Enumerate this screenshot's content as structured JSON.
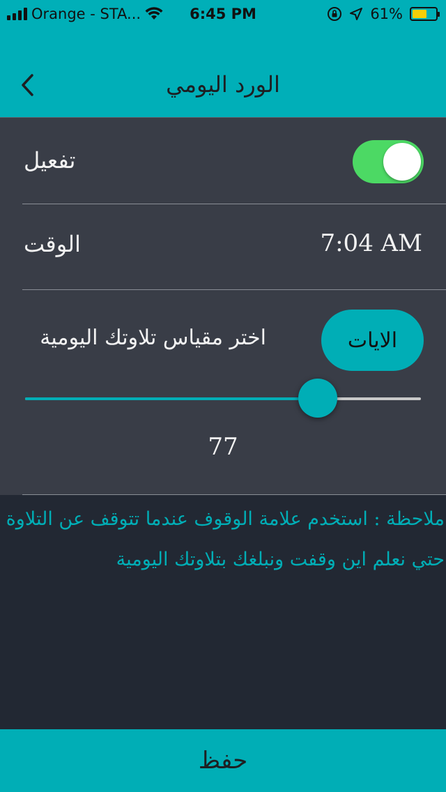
{
  "status_bar": {
    "carrier": "Orange - STA...",
    "time": "6:45 PM",
    "battery_percent": "61%",
    "battery_level": 0.61,
    "icons": [
      "signal-icon",
      "wifi-icon",
      "orientation-lock-icon",
      "location-icon",
      "battery-icon"
    ]
  },
  "nav": {
    "title": "الورد اليومي",
    "back_icon": "chevron-left-icon"
  },
  "settings": {
    "activate_label": "تفعيل",
    "activate_on": true,
    "time_label": "الوقت",
    "time_value": "7:04 AM",
    "choose_label": "اختر مقياس تلاوتك اليومية",
    "unit_button": "الايات",
    "slider_fraction": 0.74,
    "slider_value": "77"
  },
  "note": {
    "line1": "ملاحظة : استخدم علامة الوقوف عندما تتوقف عن التلاوة",
    "line2": "حتي نعلم اين وقفت ونبلغك بتلاوتك اليومية"
  },
  "footer": {
    "save_label": "حفظ"
  },
  "colors": {
    "accent": "#00aeb6",
    "panel": "#393d47",
    "background": "#222833",
    "toggle_on": "#4cd964"
  }
}
